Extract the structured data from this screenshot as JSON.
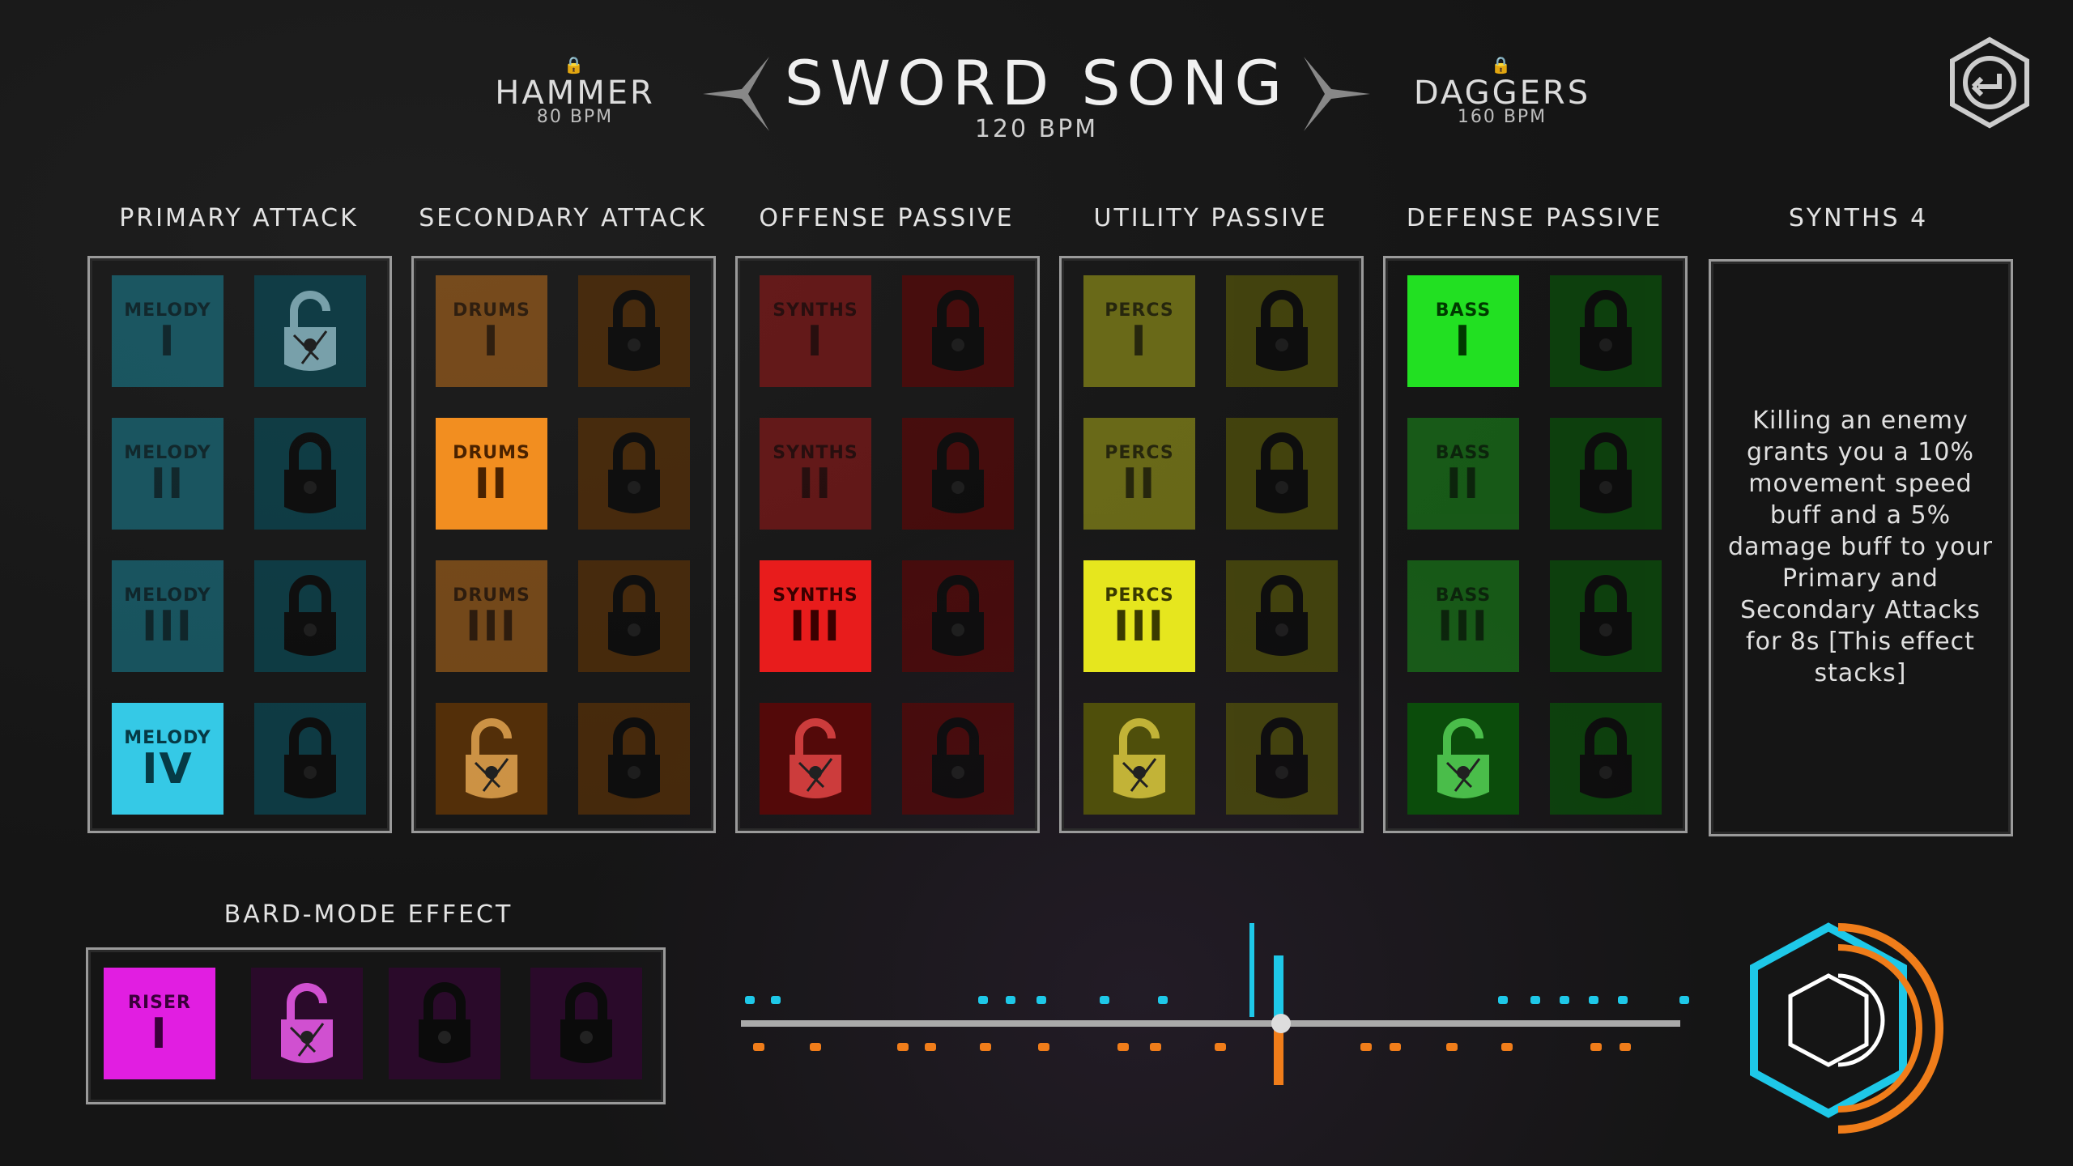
{
  "header": {
    "left_weapon": {
      "name": "HAMMER",
      "bpm": "80 BPM"
    },
    "title": "SWORD SONG",
    "title_bpm": "120 BPM",
    "right_weapon": {
      "name": "DAGGERS",
      "bpm": "160 BPM"
    },
    "back_icon": "return-icon"
  },
  "categories": [
    {
      "label": "PRIMARY ATTACK",
      "color": "#1aa6c0",
      "tiles": [
        {
          "label": "MELODY",
          "num": "I"
        },
        {
          "label": "MELODY",
          "num": "II"
        },
        {
          "label": "MELODY",
          "num": "III"
        },
        {
          "label": "MELODY",
          "num": "IV"
        }
      ]
    },
    {
      "label": "SECONDARY ATTACK",
      "color": "#f08a1c",
      "tiles": [
        {
          "label": "DRUMS",
          "num": "I"
        },
        {
          "label": "DRUMS",
          "num": "II"
        },
        {
          "label": "DRUMS",
          "num": "III"
        }
      ]
    },
    {
      "label": "OFFENSE PASSIVE",
      "color": "#e11d1d",
      "tiles": [
        {
          "label": "SYNTHS",
          "num": "I"
        },
        {
          "label": "SYNTHS",
          "num": "II"
        },
        {
          "label": "SYNTHS",
          "num": "III"
        }
      ]
    },
    {
      "label": "UTILITY PASSIVE",
      "color": "#dede1a",
      "tiles": [
        {
          "label": "PERCS",
          "num": "I"
        },
        {
          "label": "PERCS",
          "num": "II"
        },
        {
          "label": "PERCS",
          "num": "III"
        }
      ]
    },
    {
      "label": "DEFENSE PASSIVE",
      "color": "#22e022",
      "tiles": [
        {
          "label": "BASS",
          "num": "I"
        },
        {
          "label": "BASS",
          "num": "II"
        },
        {
          "label": "BASS",
          "num": "III"
        }
      ]
    }
  ],
  "info_panel": {
    "title": "SYNTHS 4",
    "description": "Killing an enemy grants you a 10% movement speed buff and a 5% damage buff to your Primary and Secondary Attacks for 8s [This effect stacks]"
  },
  "bard_mode": {
    "label": "BARD-MODE EFFECT",
    "color": "#e11ee1",
    "tile": {
      "label": "RISER",
      "num": "I"
    }
  },
  "colors": {
    "cyan": "#1ec8e8",
    "orange": "#f07d1a"
  }
}
